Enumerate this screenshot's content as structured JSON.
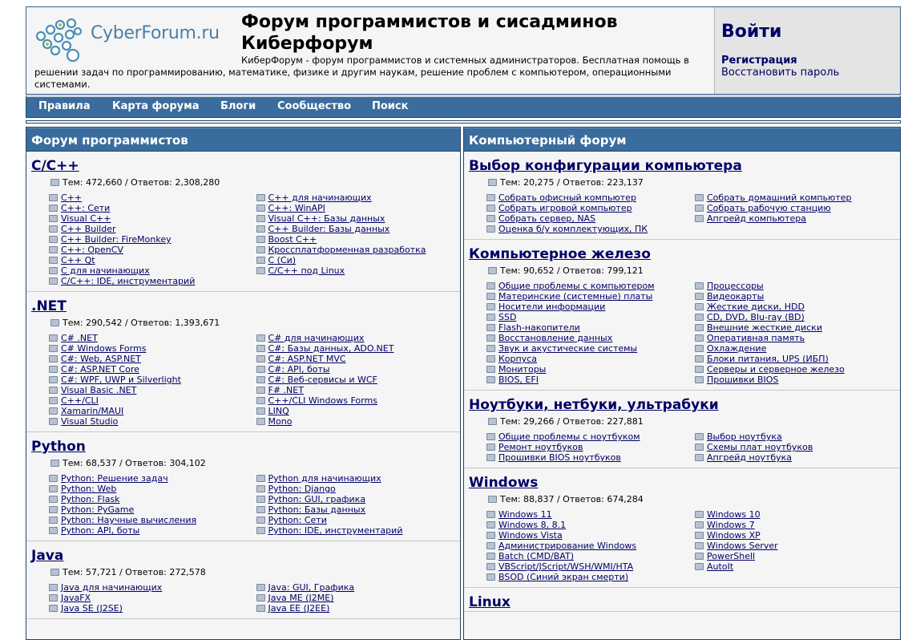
{
  "header": {
    "logo_text": "CyberForum.ru",
    "title": "Форум программистов и сисадминов Киберфорум",
    "description": "КиберФорум - форум программистов и системных администраторов. Бесплатная помощь в решении задач по программированию, математике, физике и другим наукам, решение проблем с компьютером, операционными системами."
  },
  "login": {
    "login_label": "Войти",
    "register_label": "Регистрация",
    "restore_label": "Восстановить пароль"
  },
  "nav": [
    "Правила",
    "Карта форума",
    "Блоги",
    "Сообщество",
    "Поиск"
  ],
  "left_column": {
    "title": "Форум программистов",
    "sections": [
      {
        "title": "C/C++",
        "stats": "Тем: 472,660 / Ответов: 2,308,280",
        "links": [
          "C++",
          "C++ для начинающих",
          "C++: Сети",
          "C++: WinAPI",
          "Visual C++",
          "Visual C++: Базы данных",
          "C++ Builder",
          "C++ Builder: Базы данных",
          "C++ Builder: FireMonkey",
          "Boost C++",
          "C++: OpenCV",
          "Кроссплатформенная разработка",
          "C++ Qt",
          "C (Си)",
          "C для начинающих",
          "C/C++ под Linux",
          "C/C++: IDE, инструментарий"
        ]
      },
      {
        "title": ".NET",
        "stats": "Тем: 290,542 / Ответов: 1,393,671",
        "links": [
          "C# .NET",
          "C# для начинающих",
          "C# Windows Forms",
          "C#: Базы данных, ADO.NET",
          "C#: Web, ASP.NET",
          "C#: ASP.NET MVC",
          "C#: ASP.NET Core",
          "C#: API, боты",
          "C#: WPF, UWP и Silverlight",
          "C#: Веб-сервисы и WCF",
          "Visual Basic .NET",
          "F# .NET",
          "C++/CLI",
          "C++/CLI Windows Forms",
          "Xamarin/MAUI",
          "LINQ",
          "Visual Studio",
          "Mono"
        ]
      },
      {
        "title": "Python",
        "stats": "Тем: 68,537 / Ответов: 304,102",
        "links": [
          "Python: Решение задач",
          "Python для начинающих",
          "Python: Web",
          "Python: Django",
          "Python: Flask",
          "Python: GUI, графика",
          "Python: PyGame",
          "Python: Базы данных",
          "Python: Научные вычисления",
          "Python: Сети",
          "Python: API, боты",
          "Python: IDE, инструментарий"
        ]
      },
      {
        "title": "Java",
        "stats": "Тем: 57,721 / Ответов: 272,578",
        "links": [
          "Java для начинающих",
          "Java: GUI, Графика",
          "JavaFX",
          "Java ME (J2ME)",
          "Java SE (J2SE)",
          "Java EE (J2EE)"
        ]
      }
    ]
  },
  "right_column": {
    "title": "Компьютерный форум",
    "sections": [
      {
        "title": "Выбор конфигурации компьютера",
        "stats": "Тем: 20,275 / Ответов: 223,137",
        "links": [
          "Собрать офисный компьютер",
          "Собрать домашний компьютер",
          "Собрать игровой компьютер",
          "Собрать рабочую станцию",
          "Собрать сервер, NAS",
          "Апгрейд компьютера",
          "Оценка б/у комплектующих, ПК"
        ]
      },
      {
        "title": "Компьютерное железо",
        "stats": "Тем: 90,652 / Ответов: 799,121",
        "links": [
          "Общие проблемы с компьютером",
          "Процессоры",
          "Материнские (системные) платы",
          "Видеокарты",
          "Носители информации",
          "Жесткие диски, HDD",
          "SSD",
          "CD, DVD, Blu-ray (BD)",
          "Flash-накопители",
          "Внешние жесткие диски",
          "Восстановление данных",
          "Оперативная память",
          "Звук и акустические системы",
          "Охлаждение",
          "Корпуса",
          "Блоки питания, UPS (ИБП)",
          "Мониторы",
          "Серверы и серверное железо",
          "BIOS, EFI",
          "Прошивки BIOS"
        ]
      },
      {
        "title": "Ноутбуки, нетбуки, ультрабуки",
        "stats": "Тем: 29,266 / Ответов: 227,881",
        "links": [
          "Общие проблемы с ноутбуком",
          "Выбор ноутбука",
          "Ремонт ноутбуков",
          "Схемы плат ноутбуков",
          "Прошивки BIOS ноутбуков",
          "Апгрейд ноутбука"
        ]
      },
      {
        "title": "Windows",
        "stats": "Тем: 88,837 / Ответов: 674,284",
        "links": [
          "Windows 11",
          "Windows 10",
          "Windows 8, 8.1",
          "Windows 7",
          "Windows Vista",
          "Windows XP",
          "Администрирование Windows",
          "Windows Server",
          "Batch (CMD/BAT)",
          "PowerShell",
          "VBScript/JScript/WSH/WMI/HTA",
          "AutoIt",
          "BSOD (Синий экран смерти)"
        ]
      },
      {
        "title": "Linux",
        "stats": "",
        "links": []
      }
    ]
  }
}
